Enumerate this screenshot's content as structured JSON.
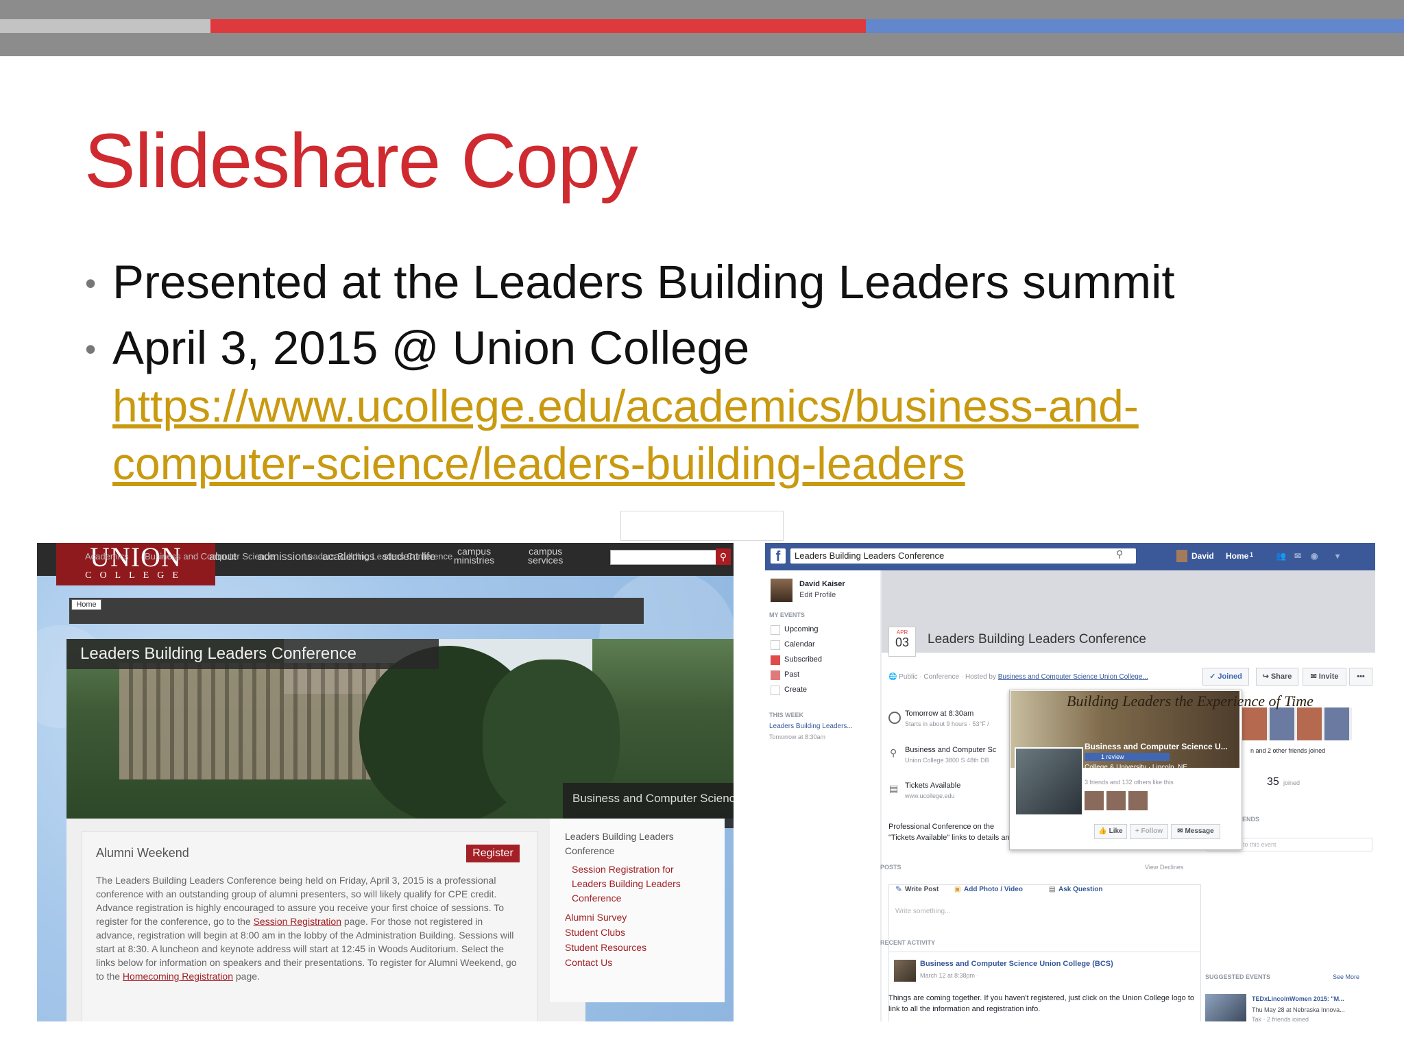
{
  "slide": {
    "title": "Slideshare Copy",
    "bullets": [
      "Presented at the Leaders Building Leaders summit",
      "April 3, 2015 @ Union College"
    ],
    "url_line_1": "https://www.ucollege.edu/academics/business-and-",
    "url_line_2": "computer-science/leaders-building-leaders",
    "accent_colors": {
      "title": "#cf2a2f",
      "link": "#c99a10",
      "bar_red": "#de3a3e",
      "bar_blue": "#6287cc"
    }
  },
  "union_site": {
    "logo_line1": "UNION",
    "logo_line2": "COLLEGE",
    "nav": [
      "about",
      "admissions",
      "academics",
      "student life"
    ],
    "nav_campus_ministries": [
      "campus",
      "ministries"
    ],
    "nav_campus_services": [
      "campus",
      "services"
    ],
    "breadcrumb": [
      "Home",
      "Academics",
      "Business and Computer Science",
      "Leaders Building Leaders Conference"
    ],
    "hero_title": "Leaders Building Leaders Conference",
    "side_title": "Business and Computer Science",
    "alumni_heading": "Alumni Weekend",
    "register_label": "Register",
    "body_part1": "The Leaders Building Leaders Conference being held on Friday, April 3, 2015 is a professional conference with an outstanding group of alumni presenters, so will likely qualify for CPE credit. Advance registration is highly encouraged to assure you receive your first choice of sessions. To register for the conference, go to the ",
    "body_link1": "Session Registration",
    "body_part2": " page. For those not registered in advance, registration will begin at 8:00 am in the lobby of the Administration Building. Sessions will start at 8:30. A luncheon and keynote address will start at 12:45 in Woods Auditorium. Select the links below for information on speakers and their presentations. To register for Alumni Weekend, go to the ",
    "body_link2": "Homecoming Registration",
    "body_part3": " page.",
    "sidebar_heading": "Leaders Building Leaders Conference",
    "sidebar_sub": "Session Registration for Leaders Building Leaders Conference",
    "sidebar_links": [
      "Alumni Survey",
      "Student Clubs",
      "Student Resources",
      "Contact Us"
    ]
  },
  "facebook": {
    "search_value": "Leaders Building Leaders Conference",
    "top_user": "David",
    "top_home": "Home",
    "top_home_count": "1",
    "profile_name": "David Kaiser",
    "edit_profile": "Edit Profile",
    "my_events_label": "MY EVENTS",
    "menu": [
      "Upcoming",
      "Calendar",
      "Subscribed",
      "Past",
      "Create"
    ],
    "this_week_label": "THIS WEEK",
    "this_week_event": "Leaders Building Leaders...",
    "this_week_time": "Tomorrow at 8:30am",
    "date_month": "APR",
    "date_day": "03",
    "event_title": "Leaders Building Leaders Conference",
    "public_line": "Public · Conference · Hosted by ",
    "host_link": "Business and Computer Science Union College...",
    "btn_joined": "Joined",
    "btn_share": "Share",
    "btn_invite": "Invite",
    "btn_more": "•••",
    "time_main": "Tomorrow at 8:30am",
    "time_sub": "Starts in about 9 hours · 53°F /",
    "place_main": "Business and Computer Sc",
    "place_sub": "Union College 3800 S 48th DB",
    "tickets_main": "Tickets Available",
    "tickets_sub": "www.ucollege.edu",
    "popup_cover_text": "Building Leaders the Experience of Time",
    "popup_name": "Business and Computer Science U...",
    "popup_review": "1 review",
    "popup_category": "College & University · Lincoln, NE",
    "popup_friends": "3 friends and 132 others like this",
    "popup_like": "Like",
    "popup_follow": "Follow",
    "popup_message": "Message",
    "joined_friends": "n and 2 other friends joined",
    "joined_count": "35",
    "joined_label": "joined",
    "friends_label": "ENDS",
    "add_friends": "Add friends to this event",
    "desc_line1": "Professional Conference on the",
    "desc_line2": "\"Tickets Available\" links to details and registration.",
    "posts_label": "POSTS",
    "view_declines": "View Declines",
    "write_post": "Write Post",
    "add_photo": "Add Photo / Video",
    "ask_question": "Ask Question",
    "write_placeholder": "Write something...",
    "recent_label": "RECENT ACTIVITY",
    "recent_name": "Business and Computer Science Union College (BCS)",
    "recent_time": "March 12 at 8:38pm ·",
    "recent_text": "Things are coming together. If you haven't registered, just click on the Union College logo to link to all the information and registration info.",
    "suggested_label": "SUGGESTED EVENTS",
    "see_more": "See More",
    "sugg_title": "TEDxLincolnWomen 2015: \"M...",
    "sugg_sub": "Thu May 28 at Nebraska Innova...",
    "sugg_sub2": "Tak · 2 friends joined"
  }
}
